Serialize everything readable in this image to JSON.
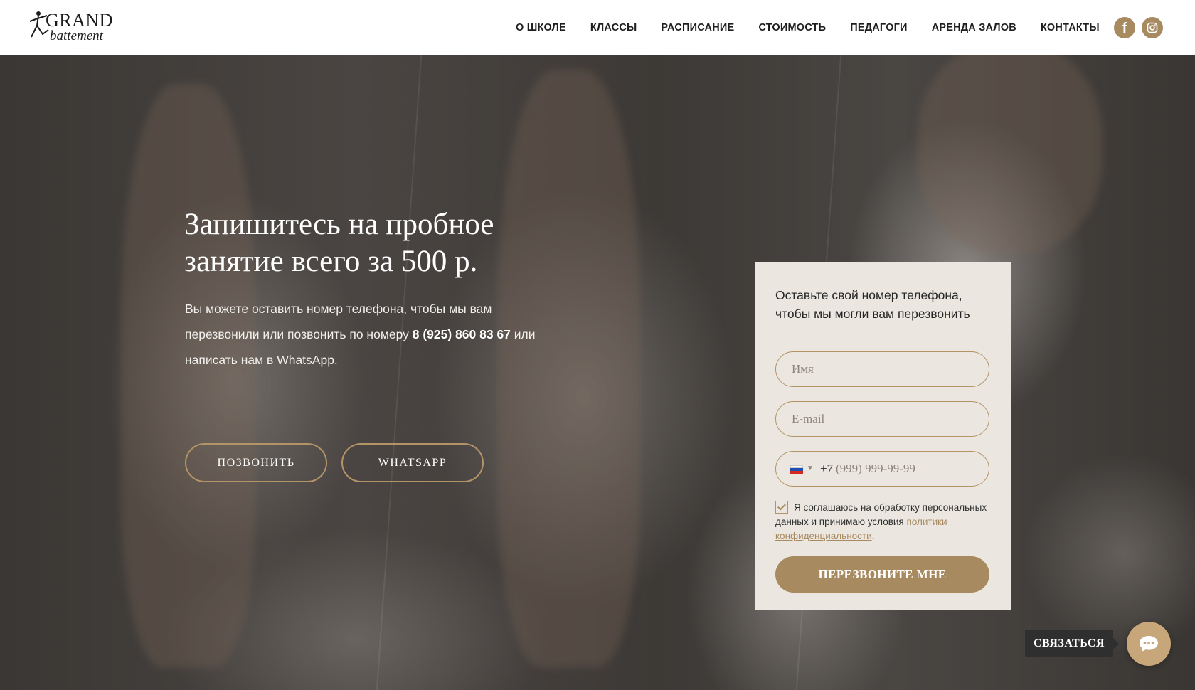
{
  "brand": {
    "logo_line1": "GRAND",
    "logo_line2": "battement"
  },
  "nav": {
    "items": [
      "О ШКОЛЕ",
      "КЛАССЫ",
      "РАСПИСАНИЕ",
      "СТОИМОСТЬ",
      "ПЕДАГОГИ",
      "АРЕНДА ЗАЛОВ",
      "КОНТАКТЫ"
    ]
  },
  "social": {
    "facebook_letter": "f",
    "icons": [
      "facebook-icon",
      "instagram-icon"
    ],
    "color": "#a88a60"
  },
  "hero": {
    "title": "Запишитесь на пробное занятие всего за 500 р.",
    "text_before": "Вы можете оставить номер телефона, чтобы мы вам перезвонили или позвонить по номеру ",
    "phone": "8 (925) 860 83 67",
    "text_after": " или написать нам в WhatsApp.",
    "call_button": "ПОЗВОНИТЬ",
    "whatsapp_button": "WHATSAPP"
  },
  "form": {
    "title": "Оставьте свой номер телефона, чтобы мы могли вам перезвонить",
    "name_placeholder": "Имя",
    "email_placeholder": "E-mail",
    "phone_country": "ru-flag",
    "phone_code": "+7",
    "phone_placeholder": "(999) 999-99-99",
    "agree_text": "Я соглашаюсь на обработку персональных данных и принимаю условия ",
    "policy_link": "политики конфиденциальности",
    "agree_end": ".",
    "agree_checked": true,
    "submit": "ПЕРЕЗВОНИТЕ МНЕ"
  },
  "widget": {
    "label": "СВЯЗАТЬСЯ",
    "icon": "chat-icon"
  },
  "colors": {
    "accent": "#a88a60",
    "form_bg": "#ebe7e0",
    "header_bg": "#ffffff"
  }
}
